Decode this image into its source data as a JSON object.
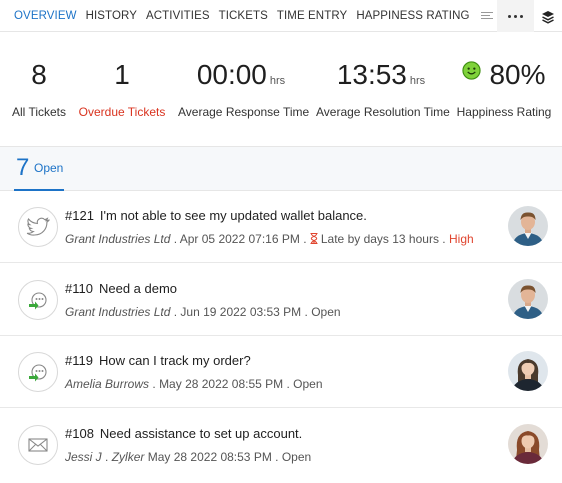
{
  "nav": {
    "tabs": [
      "OVERVIEW",
      "HISTORY",
      "ACTIVITIES",
      "TICKETS",
      "TIME ENTRY",
      "HAPPINESS RATING"
    ],
    "active_tab": "OVERVIEW",
    "accent_color": "#1d73c7"
  },
  "stats": {
    "all_tickets": {
      "value": "8",
      "label": "All Tickets"
    },
    "overdue_tickets": {
      "value": "1",
      "label": "Overdue Tickets",
      "color": "#d9331f"
    },
    "avg_response": {
      "value": "00:00",
      "unit": "hrs",
      "label": "Average Response Time"
    },
    "avg_resolution": {
      "value": "13:53",
      "unit": "hrs",
      "label": "Average Resolution Time"
    },
    "happiness": {
      "value": "80%",
      "label": "Happiness Rating",
      "icon": "smiley-icon"
    }
  },
  "open_tab": {
    "count": "7",
    "label": "Open"
  },
  "tickets": [
    {
      "number": "#121",
      "subject": "I'm not able to see my updated wallet balance.",
      "account": "Grant Industries Ltd",
      "date": "Apr 05 2022 07:16 PM",
      "late": "Late by days 13 hours",
      "priority": "High",
      "channel_icon": "twitter-icon"
    },
    {
      "number": "#110",
      "subject": "Need a demo",
      "account": "Grant Industries Ltd",
      "date": "Jun 19 2022 03:53 PM",
      "status": "Open",
      "channel_icon": "web-form-icon"
    },
    {
      "number": "#119",
      "subject": "How can I track my order?",
      "account": "Amelia Burrows",
      "date": "May 28 2022 08:55 PM",
      "status": "Open",
      "channel_icon": "web-form-icon"
    },
    {
      "number": "#108",
      "subject": "Need assistance to set up account.",
      "account": "Jessi J",
      "company": "Zylker",
      "date": "May 28 2022 08:53 PM",
      "status": "Open",
      "channel_icon": "email-icon"
    }
  ],
  "separator": "."
}
